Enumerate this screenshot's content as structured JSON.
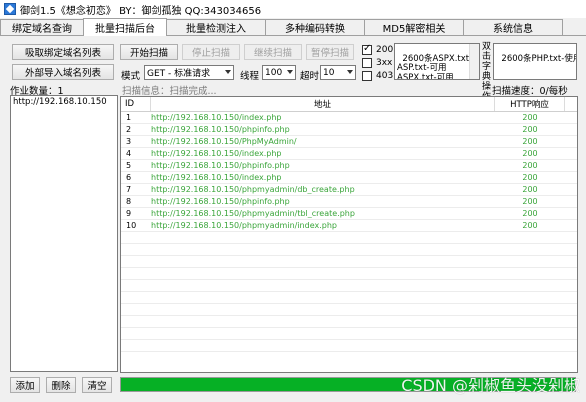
{
  "window": {
    "title": "御剑1.5《想念初恋》 BY：御剑孤独 QQ:343034656"
  },
  "tabs": [
    {
      "label": "绑定域名查询"
    },
    {
      "label": "批量扫描后台"
    },
    {
      "label": "批量检测注入"
    },
    {
      "label": "多种编码转换"
    },
    {
      "label": "MD5解密相关"
    },
    {
      "label": "系统信息"
    }
  ],
  "left": {
    "get_bound_domains": "吸取绑定域名列表",
    "import_external": "外部导入域名列表",
    "task_count": "作业数量：1",
    "items": [
      "http://192.168.10.150"
    ],
    "add": "添加",
    "delete": "删除",
    "clear": "清空"
  },
  "controls": {
    "start": "开始扫描",
    "stop": "停止扫描",
    "resume": "继续扫描",
    "pause": "暂停扫描",
    "mode_label": "模式",
    "mode_value": "GET - 标准请求",
    "threads_label": "线程",
    "threads_value": "100",
    "timeout_label": "超时",
    "timeout_value": "10"
  },
  "status_codes": [
    {
      "code": "200",
      "checked": true
    },
    {
      "code": "3xx",
      "checked": false
    },
    {
      "code": "403",
      "checked": false
    }
  ],
  "dictionaries": {
    "asp_text": "2600条ASPX.txt-可\nASP.txt-可用\nASPX.txt-可用",
    "side_label": "双击字典操作",
    "php_text": "2600条PHP.txt-使用"
  },
  "scan": {
    "info": "扫描信息：扫描完成...",
    "speed": "扫描速度：0/每秒"
  },
  "results": {
    "columns": {
      "id": "ID",
      "address": "地址",
      "status": "HTTP响应"
    },
    "rows": [
      {
        "id": "1",
        "address": "http://192.168.10.150/index.php",
        "status": "200"
      },
      {
        "id": "2",
        "address": "http://192.168.10.150/phpinfo.php",
        "status": "200"
      },
      {
        "id": "3",
        "address": "http://192.168.10.150/PhpMyAdmin/",
        "status": "200"
      },
      {
        "id": "4",
        "address": "http://192.168.10.150/index.php",
        "status": "200"
      },
      {
        "id": "5",
        "address": "http://192.168.10.150/phpinfo.php",
        "status": "200"
      },
      {
        "id": "6",
        "address": "http://192.168.10.150/index.php",
        "status": "200"
      },
      {
        "id": "7",
        "address": "http://192.168.10.150/phpmyadmin/db_create.php",
        "status": "200"
      },
      {
        "id": "8",
        "address": "http://192.168.10.150/phpinfo.php",
        "status": "200"
      },
      {
        "id": "9",
        "address": "http://192.168.10.150/phpmyadmin/tbl_create.php",
        "status": "200"
      },
      {
        "id": "10",
        "address": "http://192.168.10.150/phpmyadmin/index.php",
        "status": "200"
      }
    ]
  },
  "progress": {
    "fraction": 1.0
  },
  "watermark": "CSDN @剁椒鱼头没剁椒",
  "colors": {
    "accent_green": "#06b025",
    "result_text": "#3aa53a"
  }
}
